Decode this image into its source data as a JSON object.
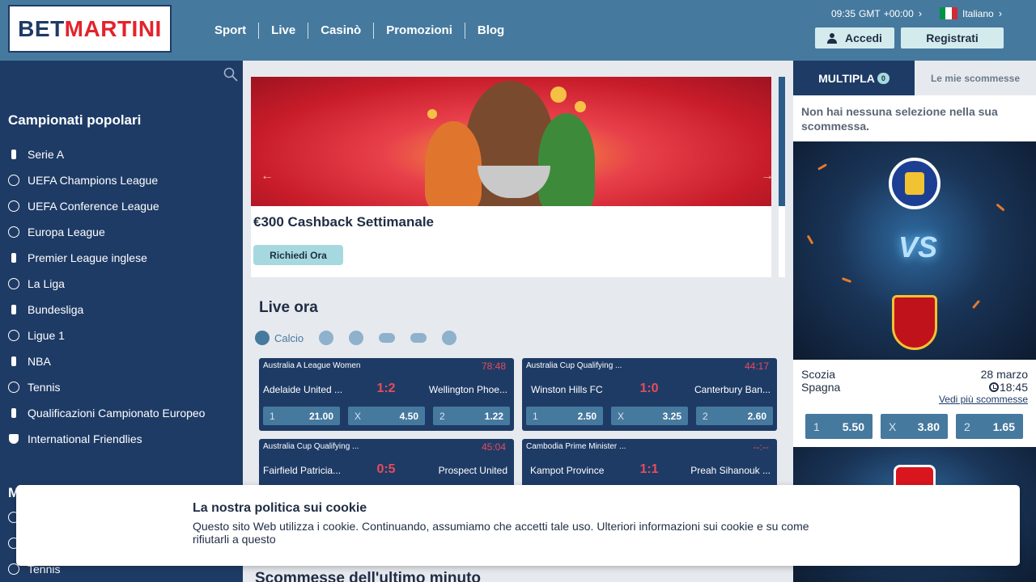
{
  "header": {
    "logo_bet": "BET",
    "logo_martini": "MARTINI",
    "nav": [
      "Sport",
      "Live",
      "Casinò",
      "Promozioni",
      "Blog"
    ],
    "time": "09:35",
    "timezone": "GMT",
    "offset": "+00:00",
    "language": "Italiano",
    "login_label": "Accedi",
    "register_label": "Registrati"
  },
  "sidebar": {
    "title": "Campionati popolari",
    "items": [
      {
        "label": "Serie A",
        "icon": "serie-a-icon"
      },
      {
        "label": "UEFA Champions League",
        "icon": "champions-league-icon"
      },
      {
        "label": "UEFA Conference League",
        "icon": "conference-league-icon"
      },
      {
        "label": "Europa League",
        "icon": "europa-league-icon"
      },
      {
        "label": "Premier League inglese",
        "icon": "premier-league-icon"
      },
      {
        "label": "La Liga",
        "icon": "la-liga-icon"
      },
      {
        "label": "Bundesliga",
        "icon": "bundesliga-icon"
      },
      {
        "label": "Ligue 1",
        "icon": "ligue-1-icon"
      },
      {
        "label": "NBA",
        "icon": "nba-icon"
      },
      {
        "label": "Tennis",
        "icon": "tennis-icon"
      },
      {
        "label": "Qualificazioni Campionato Europeo",
        "icon": "euro-qualifiers-icon"
      },
      {
        "label": "International Friendlies",
        "icon": "trophy-icon"
      }
    ],
    "section2_letter": "M",
    "section2_last_item": "Tennis"
  },
  "promo": {
    "title": "€300 Cashback Settimanale",
    "button_label": "Richiedi Ora",
    "prev_arrow": "←",
    "next_arrow": "→"
  },
  "live": {
    "title": "Live ora",
    "active_sport": "Calcio",
    "sport_icons": [
      "soccer-icon",
      "basketball-icon",
      "volleyball-icon",
      "esports-icon",
      "horse-racing-icon",
      "table-tennis-icon"
    ],
    "matches": [
      {
        "league": "Australia A League Women",
        "time": "78:48",
        "home": "Adelaide United ...",
        "score": "1:2",
        "away": "Wellington Phoe...",
        "odds": [
          {
            "l": "1",
            "v": "21.00"
          },
          {
            "l": "X",
            "v": "4.50"
          },
          {
            "l": "2",
            "v": "1.22"
          }
        ]
      },
      {
        "league": "Australia Cup Qualifying ...",
        "time": "44:17",
        "home": "Winston Hills FC",
        "score": "1:0",
        "away": "Canterbury Ban...",
        "odds": [
          {
            "l": "1",
            "v": "2.50"
          },
          {
            "l": "X",
            "v": "3.25"
          },
          {
            "l": "2",
            "v": "2.60"
          }
        ]
      },
      {
        "league": "Australia Cup Qualifying ...",
        "time": "45:04",
        "home": "Fairfield Patricia...",
        "score": "0:5",
        "away": "Prospect United",
        "odds": []
      },
      {
        "league": "Cambodia Prime Minister ...",
        "time": "--:--",
        "home": "Kampot Province",
        "score": "1:1",
        "away": "Preah Sihanouk ...",
        "odds": []
      }
    ]
  },
  "last_minute": {
    "title": "Scommesse dell'ultimo minuto"
  },
  "betslip": {
    "tab_multipla": "MULTIPLA",
    "count": "0",
    "tab_mine": "Le mie scommesse",
    "empty_message": "Non hai nessuna selezione nella sua scommessa.",
    "vs_text": "VS",
    "fixture": {
      "team1": "Scozia",
      "team2": "Spagna",
      "date": "28 marzo",
      "time": "18:45",
      "more_link": "Vedi più scommesse",
      "odds": [
        {
          "l": "1",
          "v": "5.50"
        },
        {
          "l": "X",
          "v": "3.80"
        },
        {
          "l": "2",
          "v": "1.65"
        }
      ]
    }
  },
  "cookie": {
    "title": "La nostra politica sui cookie",
    "text": "Questo sito Web utilizza i cookie. Continuando, assumiamo che accetti tale uso. Ulteriori informazioni sui cookie e su come rifiutarli a questo"
  },
  "colors": {
    "header_bg": "#46799e",
    "navy": "#1e3b66",
    "accent_red": "#e3232c",
    "live_red": "#e74c5a",
    "button_light": "#d4ebee"
  }
}
